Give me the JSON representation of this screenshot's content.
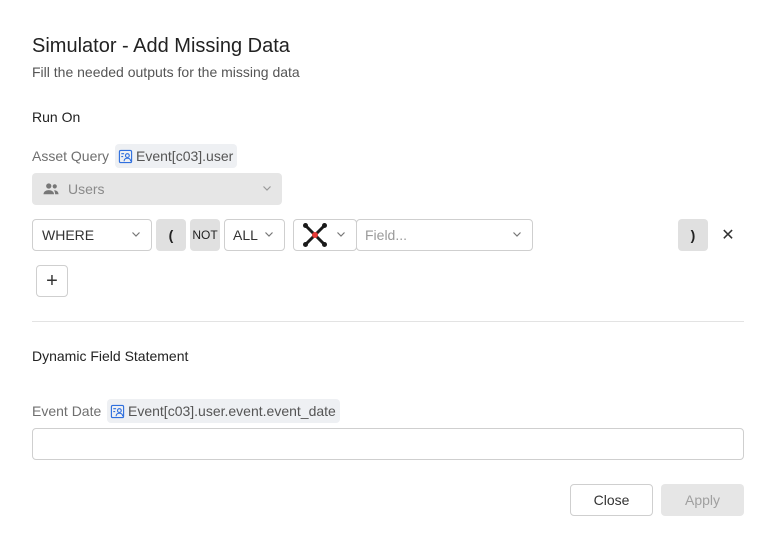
{
  "dialog": {
    "title": "Simulator - Add Missing Data",
    "subtitle": "Fill the needed outputs for the missing data"
  },
  "run_on": {
    "section_label": "Run On",
    "asset_query_label": "Asset Query",
    "asset_query_chip": "Event[c03].user",
    "entity_select_value": "Users"
  },
  "filter_row": {
    "where_value": "WHERE",
    "open_paren_label": "(",
    "not_label": "NOT",
    "all_value": "ALL",
    "field_placeholder": "Field...",
    "close_paren_label": ")",
    "remove_label": "✕"
  },
  "add_condition_label": "+",
  "dynamic_field": {
    "section_label": "Dynamic Field Statement",
    "event_date_label": "Event Date",
    "event_date_chip": "Event[c03].user.event.event_date",
    "value": ""
  },
  "footer": {
    "close_label": "Close",
    "apply_label": "Apply"
  },
  "colors": {
    "accent_icon": "#2f6fde",
    "disabled_bg": "#e6e6e6",
    "chip_bg": "#eef0f3"
  }
}
